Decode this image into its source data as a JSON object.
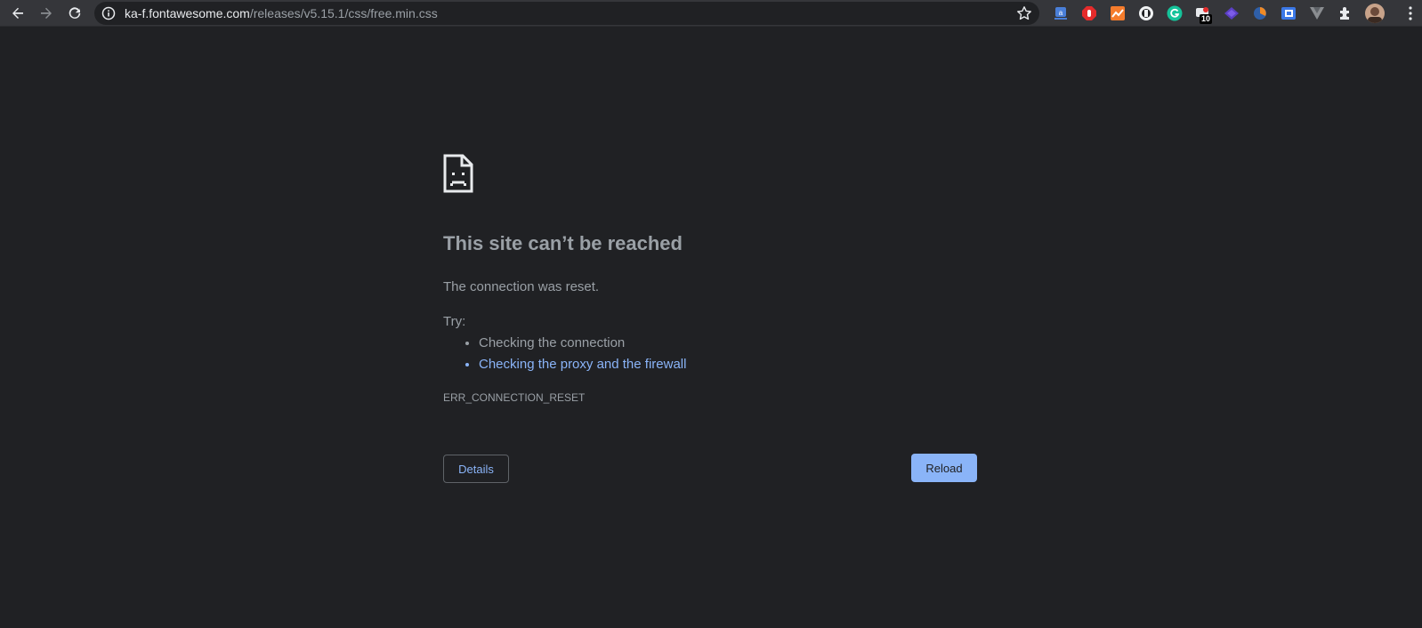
{
  "browser": {
    "url_host": "ka-f.fontawesome.com",
    "url_path": "/releases/v5.15.1/css/free.min.css",
    "extension_badge": "10",
    "icons": [
      "back-icon",
      "forward-icon",
      "reload-icon",
      "info-icon",
      "bookmark-star-icon",
      "extensions-puzzle-icon",
      "menu-dots-icon"
    ],
    "colors": {
      "toolbar": "#35363a",
      "omnibox": "#202124",
      "page_bg": "#202124"
    }
  },
  "error": {
    "icon": "sad-document-icon",
    "title": "This site can’t be reached",
    "message": "The connection was reset.",
    "try_label": "Try:",
    "suggestions": [
      {
        "text": "Checking the connection",
        "link": false
      },
      {
        "text": "Checking the proxy and the firewall",
        "link": true
      }
    ],
    "code": "ERR_CONNECTION_RESET",
    "details_label": "Details",
    "reload_label": "Reload",
    "colors": {
      "text": "#9aa0a6",
      "link": "#8ab4f8",
      "primary_button": "#8ab4f8"
    }
  }
}
